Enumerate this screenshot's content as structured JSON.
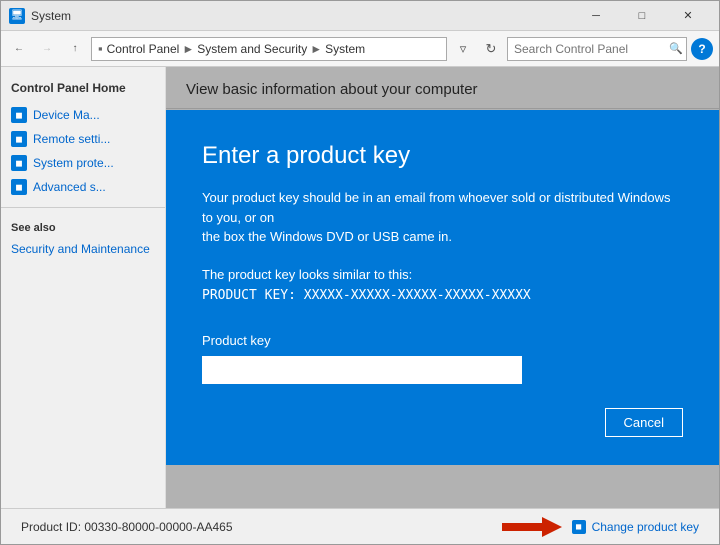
{
  "window": {
    "title": "System",
    "icon": "🖥"
  },
  "titlebar": {
    "title": "System",
    "minimize": "─",
    "maximize": "□",
    "close": "✕"
  },
  "addressbar": {
    "back": "←",
    "forward": "→",
    "up": "↑",
    "path": {
      "controlpanel": "Control Panel",
      "system_security": "System and Security",
      "system": "System"
    },
    "refresh": "⟳",
    "search_placeholder": "Search Control Panel"
  },
  "sidebar": {
    "title": "Control Panel Home",
    "links": [
      {
        "label": "Device Ma..."
      },
      {
        "label": "Remote setti..."
      },
      {
        "label": "System prote..."
      },
      {
        "label": "Advanced s..."
      }
    ],
    "see_also_title": "See also",
    "see_also_links": [
      {
        "label": "Security and Maintenance"
      }
    ]
  },
  "main": {
    "panel_title": "View basic information about your computer"
  },
  "bottom_bar": {
    "product_id_label": "Product ID:",
    "product_id": "00330-80000-00000-AA465",
    "change_key_label": "Change product key"
  },
  "dialog": {
    "title": "Enter a product key",
    "body_line1": "Your product key should be in an email from whoever sold or distributed Windows to you, or on",
    "body_line2": "the box the Windows DVD or USB came in.",
    "example_label": "The product key looks similar to this:",
    "example_key": "PRODUCT KEY: XXXXX-XXXXX-XXXXX-XXXXX-XXXXX",
    "field_label": "Product key",
    "input_placeholder": "",
    "cancel_label": "Cancel"
  },
  "colors": {
    "accent": "#0078d7",
    "link": "#0066cc",
    "dialog_bg": "#0078d7",
    "arrow_red": "#cc2200"
  }
}
